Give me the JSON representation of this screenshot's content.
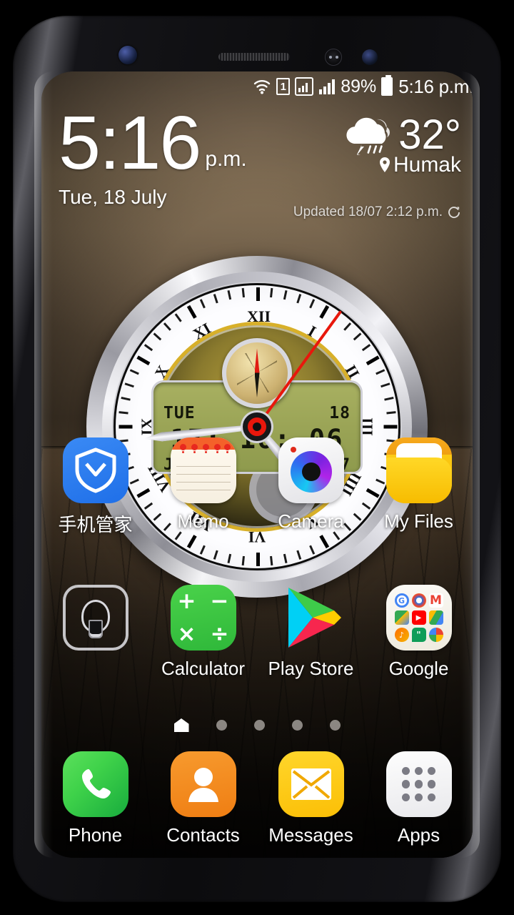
{
  "status_bar": {
    "wifi_icon": "wifi-icon",
    "sim_badge": "1",
    "signal_icon_1": "signal-boxed-icon",
    "signal_icon_2": "signal-bars-icon",
    "battery_percent": "89%",
    "battery_icon": "battery-icon",
    "clock": "5:16 p.m."
  },
  "clock_widget": {
    "time": "5:16",
    "ampm": "p.m.",
    "date": "Tue, 18 July"
  },
  "weather_widget": {
    "icon": "thunderstorm-cloud-icon",
    "temperature": "32°",
    "location_pin_icon": "location-pin-icon",
    "location": "Humak",
    "updated": "Updated 18/07 2:12 p.m.",
    "refresh_icon": "refresh-icon"
  },
  "watch_widget": {
    "name": "analog-digital-watch-widget",
    "roman_numerals": [
      "XII",
      "I",
      "II",
      "III",
      "IIII",
      "V",
      "VI",
      "VII",
      "VIII",
      "IX",
      "X",
      "XI"
    ],
    "lcd": {
      "weekday": "TUE",
      "day": "18",
      "time": "17: 16: 06",
      "month": "JULY",
      "year": "2017"
    },
    "compass": "compass-subdial",
    "hands": {
      "hour": "hour-hand",
      "minute": "minute-hand",
      "second": "second-hand"
    }
  },
  "app_rows": [
    [
      {
        "name": "tencent-security",
        "label": "手机管家",
        "icon": "shield-icon",
        "cjk": true
      },
      {
        "name": "memo",
        "label": "Memo",
        "icon": "notepad-icon",
        "cjk": false
      },
      {
        "name": "camera",
        "label": "Camera",
        "icon": "camera-icon",
        "cjk": false
      },
      {
        "name": "my-files",
        "label": "My Files",
        "icon": "folder-icon",
        "cjk": false
      }
    ],
    [
      {
        "name": "flashlight-widget",
        "label": "",
        "icon": "lightbulb-icon",
        "cjk": false
      },
      {
        "name": "calculator",
        "label": "Calculator",
        "icon": "calculator-icon",
        "cjk": false
      },
      {
        "name": "play-store",
        "label": "Play Store",
        "icon": "play-triangle-icon",
        "cjk": false
      },
      {
        "name": "google-folder",
        "label": "Google",
        "icon": "google-folder-icon",
        "cjk": false
      }
    ]
  ],
  "calculator_symbols": [
    "+",
    "−",
    "×",
    "÷"
  ],
  "google_folder_apps": [
    {
      "name": "google-search",
      "letter": "G",
      "color": "#4285f4"
    },
    {
      "name": "chrome",
      "letter": "O",
      "color": "#1a73e8"
    },
    {
      "name": "gmail",
      "letter": "M",
      "color": "#ea4335"
    },
    {
      "name": "maps",
      "letter": "",
      "color": "#34a853"
    },
    {
      "name": "youtube",
      "letter": "▶",
      "color": "#ff0000"
    },
    {
      "name": "drive",
      "letter": "▲",
      "color": "#fbbc04"
    },
    {
      "name": "play-music",
      "letter": "♪",
      "color": "#ff6d00"
    },
    {
      "name": "hangouts",
      "letter": "\"",
      "color": "#0f9d58"
    },
    {
      "name": "photos",
      "letter": "✿",
      "color": "#4285f4"
    }
  ],
  "page_indicator": {
    "count": 5,
    "active_index": 0,
    "active_icon": "home-icon"
  },
  "dock": [
    {
      "name": "phone",
      "label": "Phone",
      "icon": "handset-icon"
    },
    {
      "name": "contacts",
      "label": "Contacts",
      "icon": "person-icon"
    },
    {
      "name": "messages",
      "label": "Messages",
      "icon": "envelope-icon"
    },
    {
      "name": "apps",
      "label": "Apps",
      "icon": "app-grid-icon"
    }
  ],
  "colors": {
    "accent_blue": "#2f7ff0",
    "phone_green": "#3fd24a",
    "contacts_orange": "#ef7e13",
    "messages_yellow": "#fbbf06",
    "files_yellow": "#f5b800",
    "calculator_green": "#2fb83a",
    "second_hand_red": "#e8170c",
    "lcd_green": "#99a355"
  }
}
